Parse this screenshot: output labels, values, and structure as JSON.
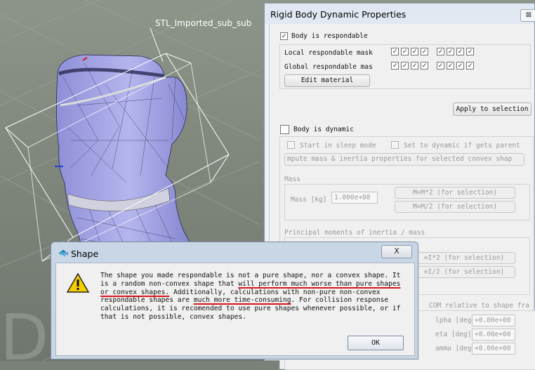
{
  "viewport": {
    "object_label": "STL_Imported_sub_sub"
  },
  "props": {
    "title": "Rigid Body Dynamic Properties",
    "close": "⊠",
    "respondable": {
      "label": "Body is respondable",
      "checked": true
    },
    "local_mask_label": "Local respondable mask",
    "global_mask_label": "Global respondable mas",
    "local_mask": [
      true,
      true,
      true,
      true,
      true,
      true,
      true,
      true
    ],
    "global_mask": [
      true,
      true,
      true,
      true,
      true,
      true,
      true,
      true
    ],
    "edit_material": "Edit material",
    "apply_selection": "Apply to selection",
    "dynamic": {
      "label": "Body is dynamic",
      "checked": false
    },
    "sleep_mode": "Start in sleep mode",
    "set_dynamic": "Set to dynamic if gets parent",
    "compute_button": "mpute mass & inertia properties for selected convex shap",
    "mass_section": "Mass",
    "mass_label": "Mass [kg]",
    "mass_value": "1.000e+00",
    "mass_x2": "M=M*2  (for selection)",
    "mass_div2": "M=M/2  (for selection)",
    "inertia_section": "Principal moments of inertia / mass",
    "inertia_x2": "=I*2  (for selection)",
    "inertia_div2": "=I/2  (for selection)",
    "com_section": "COM relative to shape fra",
    "alpha_label": "lpha [deg]",
    "beta_label": "eta [deg]",
    "gamma_label": "amma [deg]",
    "alpha_value": "+0.00e+00",
    "beta_value": "+0.00e+00",
    "gamma_value": "+0.00e+00"
  },
  "dialog": {
    "title": "Shape",
    "close": "X",
    "msg_1": "The shape you made respondable is not a pure shape, nor a convex shape. It is a random non-convex shape that ",
    "msg_u1": "will perform much worse than pure shapes or convex shapes.",
    "msg_2": " Additionally, calculations with non-pure non-convex respondable shapes are ",
    "msg_u2": "much more time-consuming",
    "msg_3": ". For collision response calculations, it is recomended to use pure shapes whenever possible, or if that is not possible, convex shapes.",
    "ok": "OK"
  },
  "colors": {
    "mesh": "#a8a8e8",
    "mesh_lines": "#2a2a55",
    "bbox": "#ffffff",
    "underline": "#d8141a",
    "warning": "#f5d000"
  }
}
